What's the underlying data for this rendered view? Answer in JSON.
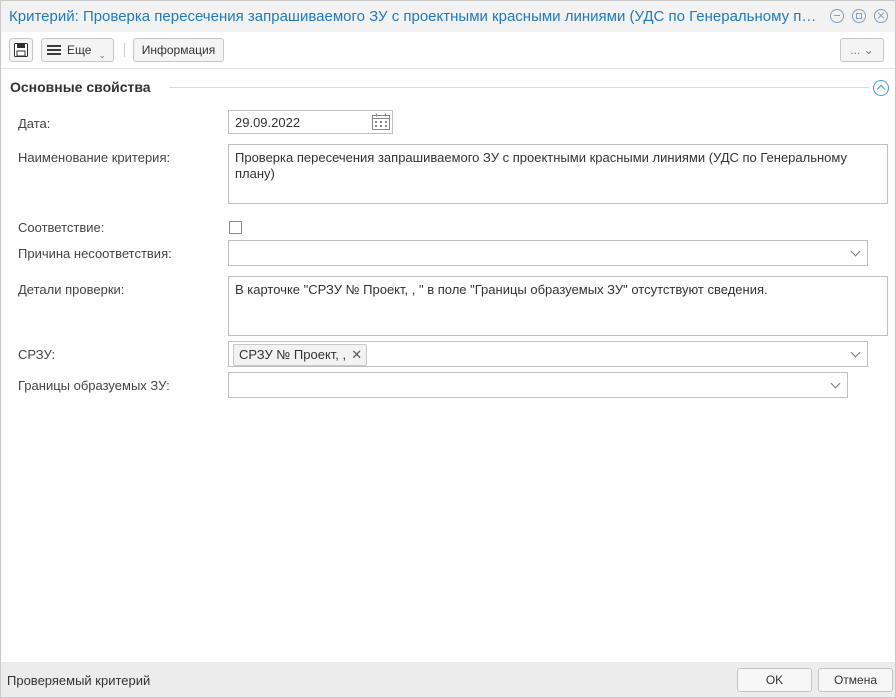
{
  "window": {
    "title": "Критерий: Проверка пересечения запрашиваемого ЗУ с проектными красными линиями (УДС по Генеральному плану)"
  },
  "toolbar": {
    "more_label": "Еще",
    "info_label": "Информация",
    "dots_label": "..."
  },
  "section": {
    "title": "Основные свойства"
  },
  "form": {
    "date_label": "Дата:",
    "date_value": "29.09.2022",
    "name_label": "Наименование критерия:",
    "name_value": "Проверка пересечения запрашиваемого ЗУ с проектными красными линиями (УДС по Генеральному плану)",
    "compliance_label": "Соответствие:",
    "compliance_checked": false,
    "reason_label": "Причина несоответствия:",
    "reason_value": "",
    "details_label": "Детали проверки:",
    "details_value": "В карточке \"СРЗУ № Проект, , \" в поле \"Границы образуемых ЗУ\" отсутствуют сведения.",
    "srzu_label": "СРЗУ:",
    "srzu_tag": "СРЗУ № Проект, ,",
    "bounds_label": "Границы образуемых ЗУ:",
    "bounds_value": ""
  },
  "footer": {
    "status": "Проверяемый критерий",
    "ok_label": "OK",
    "cancel_label": "Отмена"
  },
  "colors": {
    "title_blue": "#1e7ac8",
    "accent_blue": "#4a9ad4"
  }
}
